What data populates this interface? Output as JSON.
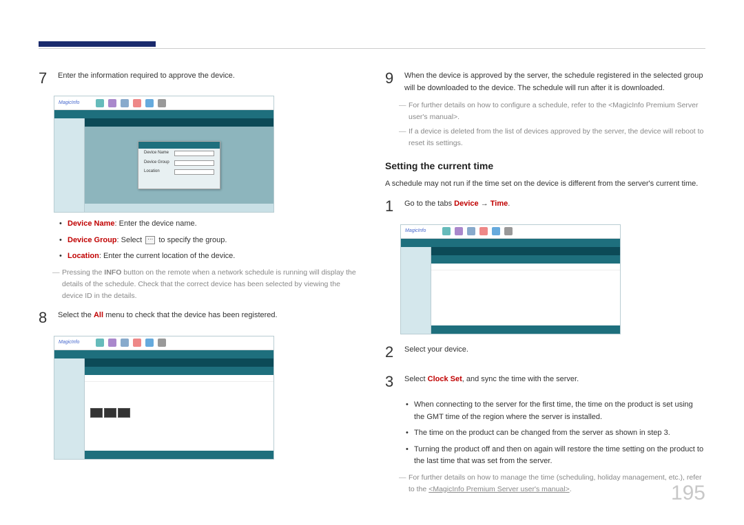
{
  "page_number": "195",
  "left": {
    "step7": {
      "num": "7",
      "text": "Enter the information required to approve the device."
    },
    "bullets7": [
      {
        "label": "Device Name",
        "text": ": Enter the device name."
      },
      {
        "label": "Device Group",
        "text_before": ": Select ",
        "text_after": " to specify the group."
      },
      {
        "label": "Location",
        "text": ": Enter the current location of the device."
      }
    ],
    "note7": {
      "prefix": "Pressing the ",
      "bold": "INFO",
      "suffix": " button on the remote when a network schedule is running will display the details of the schedule. Check that the correct device has been selected by viewing the device ID in the details."
    },
    "step8": {
      "num": "8",
      "text_before": "Select the ",
      "bold": "All",
      "text_after": " menu to check that the device has been registered."
    }
  },
  "right": {
    "step9": {
      "num": "9",
      "text": "When the device is approved by the server, the schedule registered in the selected group will be downloaded to the device. The schedule will run after it is downloaded."
    },
    "note9a": "For further details on how to configure a schedule, refer to the <MagicInfo Premium Server user's manual>.",
    "note9b": "If a device is deleted from the list of devices approved by the server, the device will reboot to reset its settings.",
    "section_title": "Setting the current time",
    "section_intro": "A schedule may not run if the time set on the device is different from the server's current time.",
    "step1": {
      "num": "1",
      "text_before": "Go to the tabs ",
      "bold1": "Device",
      "arrow": " → ",
      "bold2": "Time",
      "text_after": "."
    },
    "step2": {
      "num": "2",
      "text": "Select your device."
    },
    "step3": {
      "num": "3",
      "text_before": "Select ",
      "bold": "Clock Set",
      "text_after": ", and sync the time with the server."
    },
    "bullets3": [
      "When connecting to the server for the first time, the time on the product is set using the GMT time of the region where the server is installed.",
      "The time on the product can be changed from the server as shown in step 3.",
      "Turning the product off and then on again will restore the time setting on the product to the last time that was set from the server."
    ],
    "note3": {
      "prefix": "For further details on how to manage the time (scheduling, holiday management, etc.), refer to the ",
      "link": "<MagicInfo Premium Server user's manual>",
      "suffix": "."
    }
  },
  "screenshot_labels": {
    "logo": "MagicInfo",
    "dialog_rows": [
      "Device Name",
      "Device Group",
      "Location"
    ]
  }
}
